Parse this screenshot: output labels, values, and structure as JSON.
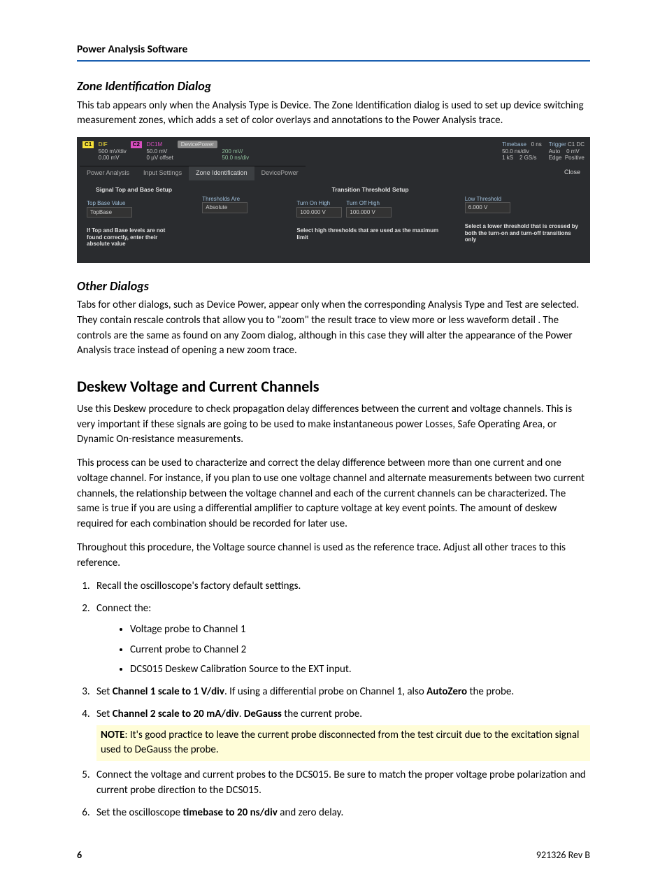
{
  "header": {
    "doc_title": "Power Analysis Software"
  },
  "sec1": {
    "title": "Zone Identification Dialog",
    "p1": "This tab appears only when the Analysis Type is Device. The Zone Identification dialog is used to set up device switching measurement zones, which adds a set of color overlays and annotations to the Power Analysis trace."
  },
  "screenshot": {
    "top": {
      "c1": "C1",
      "c1_a": "DIF",
      "c1_b": "500 mV/div",
      "c1_c": "0.00 mV",
      "c2": "C2",
      "c2_a": "DC1M",
      "c2_b": "50.0 mV",
      "c2_c": "0 µV offset",
      "dp": "DevicePower",
      "dp_a": "200 mV/",
      "dp_b": "50.0 ns/div",
      "tb_label": "Timebase",
      "tb_a": "0 ns",
      "tb_b": "50.0 ns/div",
      "tb_c": "1 kS",
      "tb_d": "2 GS/s",
      "trg_label": "Trigger",
      "trg_a": "C1 DC",
      "trg_b": "Auto",
      "trg_c": "0 mV",
      "trg_d": "Edge",
      "trg_e": "Positive"
    },
    "tabs": {
      "t1": "Power Analysis",
      "t2": "Input Settings",
      "t3": "Zone Identification",
      "t4": "DevicePower",
      "close": "Close"
    },
    "col1": {
      "title": "Signal Top and Base Setup",
      "f1_label": "Top Base Value",
      "f1_value": "TopBase",
      "help": "If Top and Base levels are not found correctly, enter their absolute value"
    },
    "col2": {
      "title": "Transition Threshold Setup",
      "fa_label": "Thresholds Are",
      "fa_value": "Absolute",
      "fb_label": "Turn On High",
      "fb_value": "100.000 V",
      "fc_label": "Turn Off High",
      "fc_value": "100.000 V",
      "fd_label": "Low Threshold",
      "fd_value": "6.000 V",
      "help1": "Select high thresholds that are used as the maximum limit",
      "help2": "Select a lower threshold that is crossed by both the turn-on and turn-off transitions only"
    }
  },
  "sec2": {
    "title": "Other Dialogs",
    "p1": "Tabs for other dialogs, such as Device Power, appear only when the corresponding Analysis Type and Test are selected. They contain rescale controls that allow you to \"zoom\" the result trace to view more or less waveform detail . The controls are the same as found on any Zoom dialog, although in this case they will alter the appearance of the Power Analysis trace instead of opening a new zoom trace."
  },
  "sec3": {
    "title": "Deskew Voltage and Current Channels",
    "p1": "Use this Deskew procedure to check propagation delay differences between the current and voltage channels. This is very important if these signals are going to be used to make instantaneous power Losses, Safe Operating Area, or Dynamic On-resistance measurements.",
    "p2": "This process can be used to characterize and correct the delay difference between more than one current and one voltage channel. For instance, if you plan to use one voltage channel and alternate measurements between two current channels, the relationship between the voltage channel and each of the current channels can be characterized. The same is true if you are using a differential amplifier to capture voltage at key event points. The amount of deskew required for each combination should be recorded for later use.",
    "p3": "Throughout this procedure, the Voltage source channel is used as the reference trace. Adjust all other traces to this reference.",
    "li1": "Recall the oscilloscope's factory default settings.",
    "li2": "Connect the:",
    "li2a": "Voltage probe to Channel 1",
    "li2b": "Current probe to Channel 2",
    "li2c": "DCS015 Deskew Calibration Source to the EXT input.",
    "li3_a": "Set ",
    "li3_b": "Channel 1 scale to 1 V/div",
    "li3_c": ". If using a differential probe on Channel 1, also ",
    "li3_d": "AutoZero",
    "li3_e": " the probe.",
    "li4_a": "Set ",
    "li4_b": "Channel 2 scale to 20 mA/div",
    "li4_c": ". ",
    "li4_d": "DeGauss",
    "li4_e": " the current probe.",
    "note_a": "NOTE",
    "note_b": ": It's good practice to leave the current probe disconnected from the test circuit due to the excitation signal used to DeGauss the probe.",
    "li5": "Connect the voltage and current probes to the DCS015. Be sure to match the proper voltage probe polarization and current probe direction to the DCS015.",
    "li6_a": "Set the oscilloscope ",
    "li6_b": "timebase to 20 ns/div",
    "li6_c": " and zero delay."
  },
  "footer": {
    "page": "6",
    "docref": "921326 Rev B"
  }
}
